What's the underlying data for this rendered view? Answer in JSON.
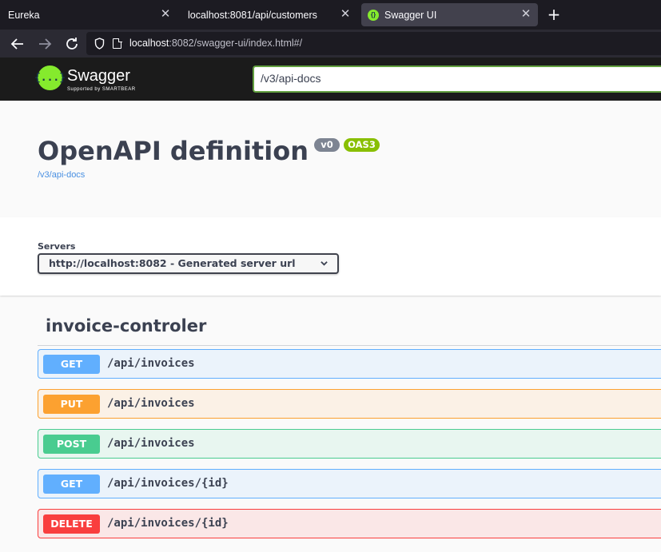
{
  "browser": {
    "tabs": [
      {
        "title": "Eureka"
      },
      {
        "title": "localhost:8081/api/customers"
      },
      {
        "title": "Swagger UI",
        "active": true
      }
    ],
    "url_host": "localhost",
    "url_rest": ":8082/swagger-ui/index.html#/"
  },
  "topbar": {
    "logo_text": "Swagger",
    "logo_sub": "Supported by SMARTBEAR",
    "logo_glyph": "{...}",
    "spec_url": "/v3/api-docs"
  },
  "info": {
    "title": "OpenAPI definition",
    "version": "v0",
    "oas": "OAS3",
    "link": "/v3/api-docs"
  },
  "servers": {
    "label": "Servers",
    "selected": "http://localhost:8082 - Generated server url"
  },
  "tag": {
    "name": "invoice-controler"
  },
  "operations": [
    {
      "method": "GET",
      "path": "/api/invoices"
    },
    {
      "method": "PUT",
      "path": "/api/invoices"
    },
    {
      "method": "POST",
      "path": "/api/invoices"
    },
    {
      "method": "GET",
      "path": "/api/invoices/{id}"
    },
    {
      "method": "DELETE",
      "path": "/api/invoices/{id}"
    }
  ],
  "colors": {
    "get": "#61affe",
    "put": "#fca130",
    "post": "#49cc90",
    "delete": "#f93e3e",
    "swagger_green": "#85ea2d"
  },
  "icons": {
    "tab_close": "close-icon",
    "new_tab": "plus-icon",
    "back": "arrow-left-icon",
    "forward": "arrow-right-icon",
    "reload": "reload-icon",
    "tracking": "shield-icon",
    "page": "page-icon",
    "select_chevron": "chevron-down-icon"
  }
}
